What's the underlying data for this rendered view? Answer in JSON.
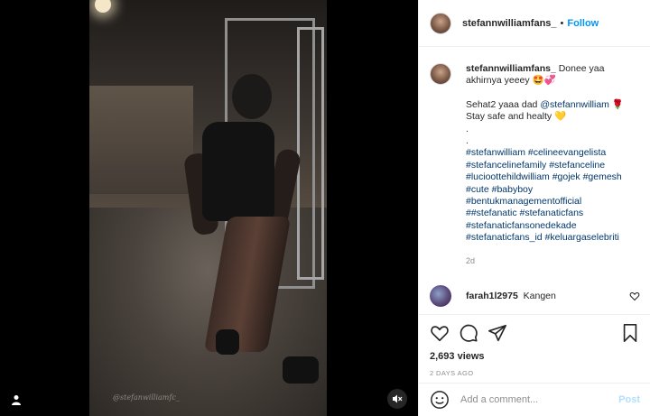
{
  "post": {
    "username": "stefannwilliamfans_",
    "follow_label": "Follow",
    "separator": "•",
    "caption": {
      "username": "stefannwilliamfans_",
      "text_line1": "Donee yaa akhirnya yeeey",
      "emoji1": "🤩💞",
      "line2_prefix": "Sehat2 yaaa dad ",
      "mention": "@stefannwilliam",
      "emoji2": "🌹",
      "line3": "Stay safe and healty",
      "emoji3": "💛",
      "dot1": ".",
      "dot2": ".",
      "hashtags": [
        "#stefanwilliam #celineevangelista",
        "#stefancelinefamily #stefanceline",
        "#lucioottehildwilliam #gojek #gemesh",
        "#cute #babyboy",
        "#bentukmanagementofficial",
        "##stefanatic #stefanaticfans",
        "#stefanaticfansonedekade",
        "#stefanaticfans_id #keluargaselebriti"
      ],
      "time": "2d"
    },
    "comment": {
      "username": "farah1l2975",
      "text": "Kangen"
    },
    "views": "2,693 views",
    "date": "2 DAYS AGO",
    "add_comment_placeholder": "Add a comment...",
    "post_label": "Post"
  },
  "video": {
    "watermark": "@stefanwilliamfc_"
  },
  "colors": {
    "link": "#00376b",
    "follow": "#0095f6",
    "muted": "#8e8e8e",
    "post_disabled": "#b2dffc"
  }
}
